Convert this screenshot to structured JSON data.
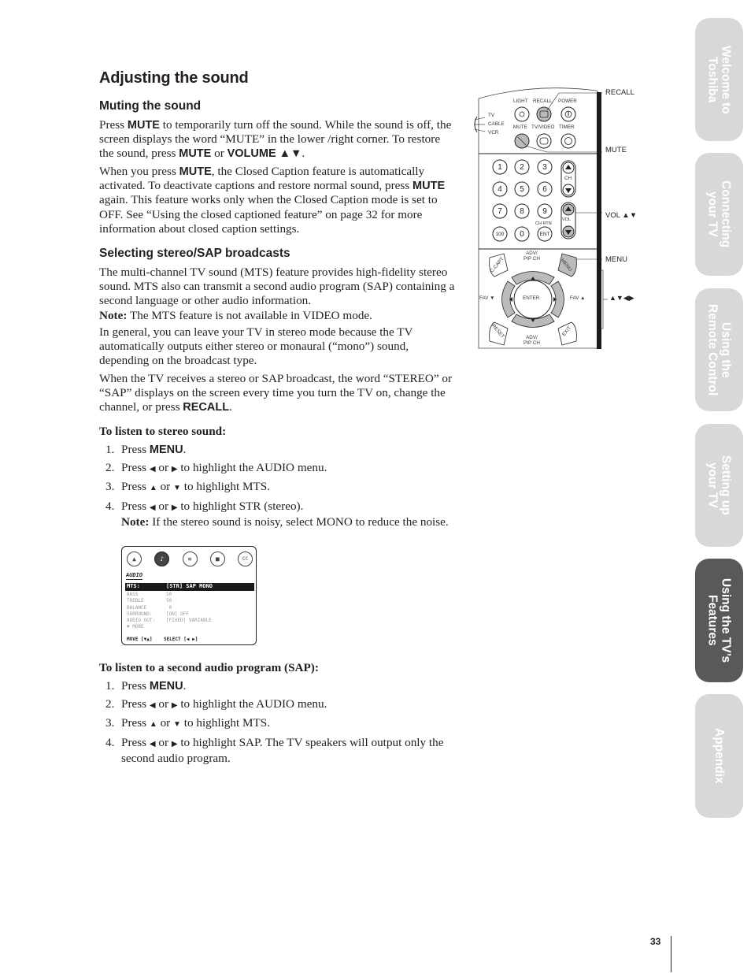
{
  "page": {
    "title": "Adjusting the sound",
    "number": "33"
  },
  "muting": {
    "heading": "Muting the sound",
    "p1": {
      "t1": "Press ",
      "k1": "MUTE",
      "t2": " to temporarily turn off the sound. While the sound is off, the screen displays the word “MUTE” in the lower /right corner. To restore the sound, press ",
      "k2": "MUTE",
      "t3": " or ",
      "k3": "VOLUME ▲▼",
      "t4": "."
    },
    "p2": {
      "t1": "When you press ",
      "k1": "MUTE",
      "t2": ", the Closed Caption feature is automatically activated. To deactivate captions and restore normal sound, press ",
      "k2": "MUTE",
      "t3": " again. This feature works only when the Closed Caption mode is set to OFF. See “Using the closed captioned feature” on page 32 for more information about closed caption settings."
    }
  },
  "stereo": {
    "heading": "Selecting stereo/SAP broadcasts",
    "p1": "The multi-channel TV sound (MTS) feature provides high-fidelity stereo sound. MTS also can transmit a second audio program (SAP) containing a second language or other audio information.",
    "p1_note_label": "Note:",
    "p1_note": " The MTS feature is not available in VIDEO mode.",
    "p2": "In general, you can leave your TV in stereo mode because the TV automatically outputs either stereo or monaural (“mono”) sound, depending on the broadcast type.",
    "p3": {
      "t1": "When the TV receives a stereo or SAP broadcast, the word “STEREO” or “SAP” displays on the screen every time you turn the TV on, change the channel, or press ",
      "k1": "RECALL",
      "t2": "."
    }
  },
  "stereo_steps": {
    "title": "To listen to stereo sound:",
    "steps": [
      {
        "num": "1.",
        "t1": "Press ",
        "k1": "MENU",
        "t2": "."
      },
      {
        "num": "2.",
        "t1": "Press ",
        "a1": "◀",
        "t2": " or ",
        "a2": "▶",
        "t3": " to highlight the AUDIO menu."
      },
      {
        "num": "3.",
        "t1": "Press ",
        "a1": "▲",
        "t2": " or ",
        "a2": "▼",
        "t3": " to highlight MTS."
      },
      {
        "num": "4.",
        "t1": "Press ",
        "a1": "◀",
        "t2": " or ",
        "a2": "▶",
        "t3": " to highlight STR (stereo).",
        "note_label": "Note:",
        "note": " If the stereo sound is noisy, select MONO to reduce the noise."
      }
    ]
  },
  "sap_steps": {
    "title": "To listen to a second audio program (SAP):",
    "steps": [
      {
        "num": "1.",
        "t1": "Press ",
        "k1": "MENU",
        "t2": "."
      },
      {
        "num": "2.",
        "t1": "Press ",
        "a1": "◀",
        "t2": " or ",
        "a2": "▶",
        "t3": " to highlight the AUDIO menu."
      },
      {
        "num": "3.",
        "t1": "Press ",
        "a1": "▲",
        "t2": " or ",
        "a2": "▼",
        "t3": " to highlight MTS."
      },
      {
        "num": "4.",
        "t1": "Press ",
        "a1": "◀",
        "t2": " or ",
        "a2": "▶",
        "t3": " to highlight SAP. The TV speakers will output only the second audio program."
      }
    ]
  },
  "osd": {
    "icons": [
      "picture-icon",
      "audio-icon",
      "setup-icon",
      "theater-icon",
      "cc-icon"
    ],
    "icon_glyphs": [
      "▲",
      "♪",
      "≡",
      "■",
      "CC"
    ],
    "selected_icon": 1,
    "menu_title": "AUDIO",
    "rows": [
      {
        "label": "MTS:",
        "value": "[STR] SAP MONO",
        "highlight": true
      },
      {
        "label": "BASS",
        "value": "50"
      },
      {
        "label": "TREBLE",
        "value": "50"
      },
      {
        "label": "BALANCE",
        "value": " 0"
      },
      {
        "label": "SURROUND:",
        "value": "[ON] OFF"
      },
      {
        "label": "AUDIO OUT:",
        "value": "[FIXED] VARIABLE"
      },
      {
        "label": "▼ MORE",
        "value": ""
      }
    ],
    "footer": "MOVE [▼▲]    SELECT [◀ ▶]"
  },
  "remote": {
    "source_labels": [
      "TV",
      "CABLE",
      "VCR"
    ],
    "top_labels_row1": [
      "LIGHT",
      "RECALL",
      "POWER"
    ],
    "top_labels_row2": [
      "MUTE",
      "TV/VIDEO",
      "TIMER"
    ],
    "digits": [
      "1",
      "2",
      "3",
      "4",
      "5",
      "6",
      "7",
      "8",
      "9",
      "100",
      "0",
      "ENT"
    ],
    "ch_label": "CH",
    "vol_label": "VOL",
    "ch_rtn_label": "CH RTN",
    "nav": {
      "top": "ADV/\nPIP CH",
      "bottom": "ADV/\nPIP CH",
      "left": "FAV ▼",
      "right": "FAV ▲",
      "center": "ENTER",
      "c_capt": "C.CAPT",
      "menu": "MENU",
      "reset": "RESET",
      "exit": "EXIT"
    },
    "callouts": [
      "RECALL",
      "MUTE",
      "VOL ▲▼",
      "MENU",
      "▲▼◀▶"
    ]
  },
  "side_tabs": [
    {
      "label": "Welcome to\nToshiba",
      "active": false
    },
    {
      "label": "Connecting\nyour TV",
      "active": false
    },
    {
      "label": "Using the\nRemote Control",
      "active": false
    },
    {
      "label": "Setting up\nyour TV",
      "active": false
    },
    {
      "label": "Using the TV’s\nFeatures",
      "active": true
    },
    {
      "label": "Appendix",
      "active": false
    }
  ]
}
